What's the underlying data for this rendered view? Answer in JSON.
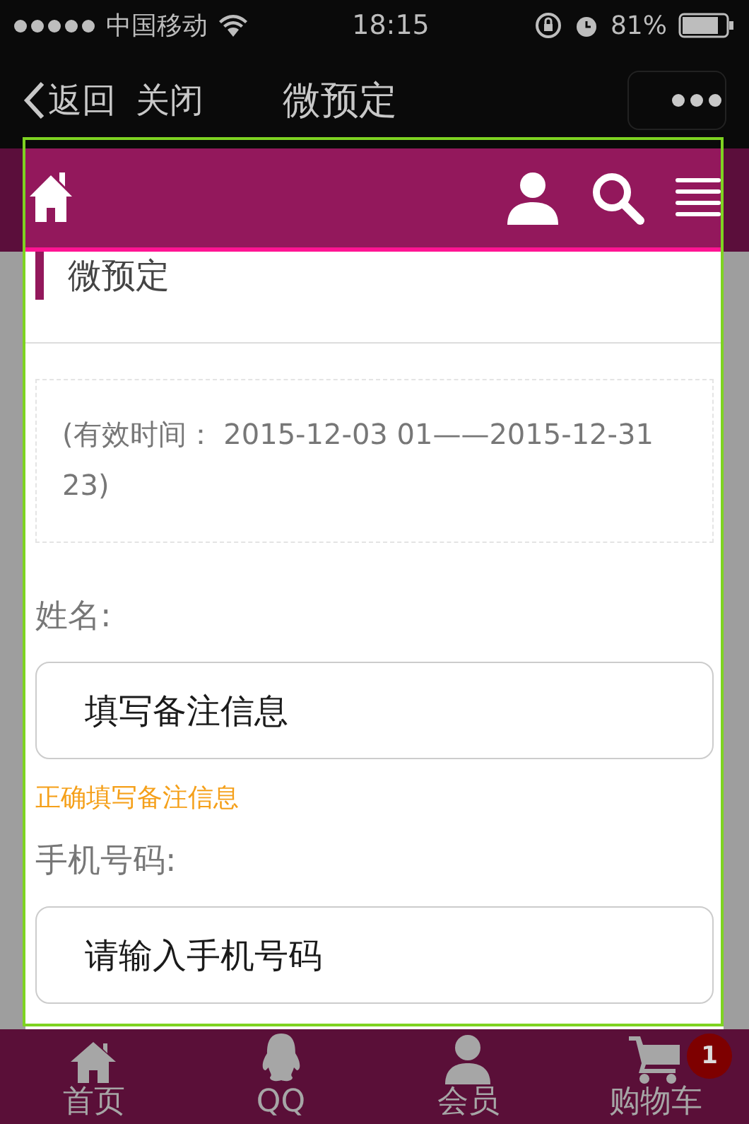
{
  "status_bar": {
    "carrier": "中国移动",
    "time": "18:15",
    "battery": "81%"
  },
  "nav_bar": {
    "back": "返回",
    "close": "关闭",
    "title": "微预定"
  },
  "page": {
    "title": "微预定",
    "validity": "(有效时间：  2015-12-03 01——2015-12-31 23)"
  },
  "form": {
    "fields": [
      {
        "label": "姓名:",
        "placeholder": "填写备注信息",
        "hint": "正确填写备注信息"
      },
      {
        "label": "手机号码:",
        "placeholder": "请输入手机号码"
      }
    ]
  },
  "tab_bar": {
    "items": [
      {
        "label": "首页",
        "kind": "home"
      },
      {
        "label": "QQ",
        "kind": "qq"
      },
      {
        "label": "会员",
        "kind": "user"
      },
      {
        "label": "购物车",
        "kind": "cart",
        "badge": "1"
      }
    ]
  }
}
